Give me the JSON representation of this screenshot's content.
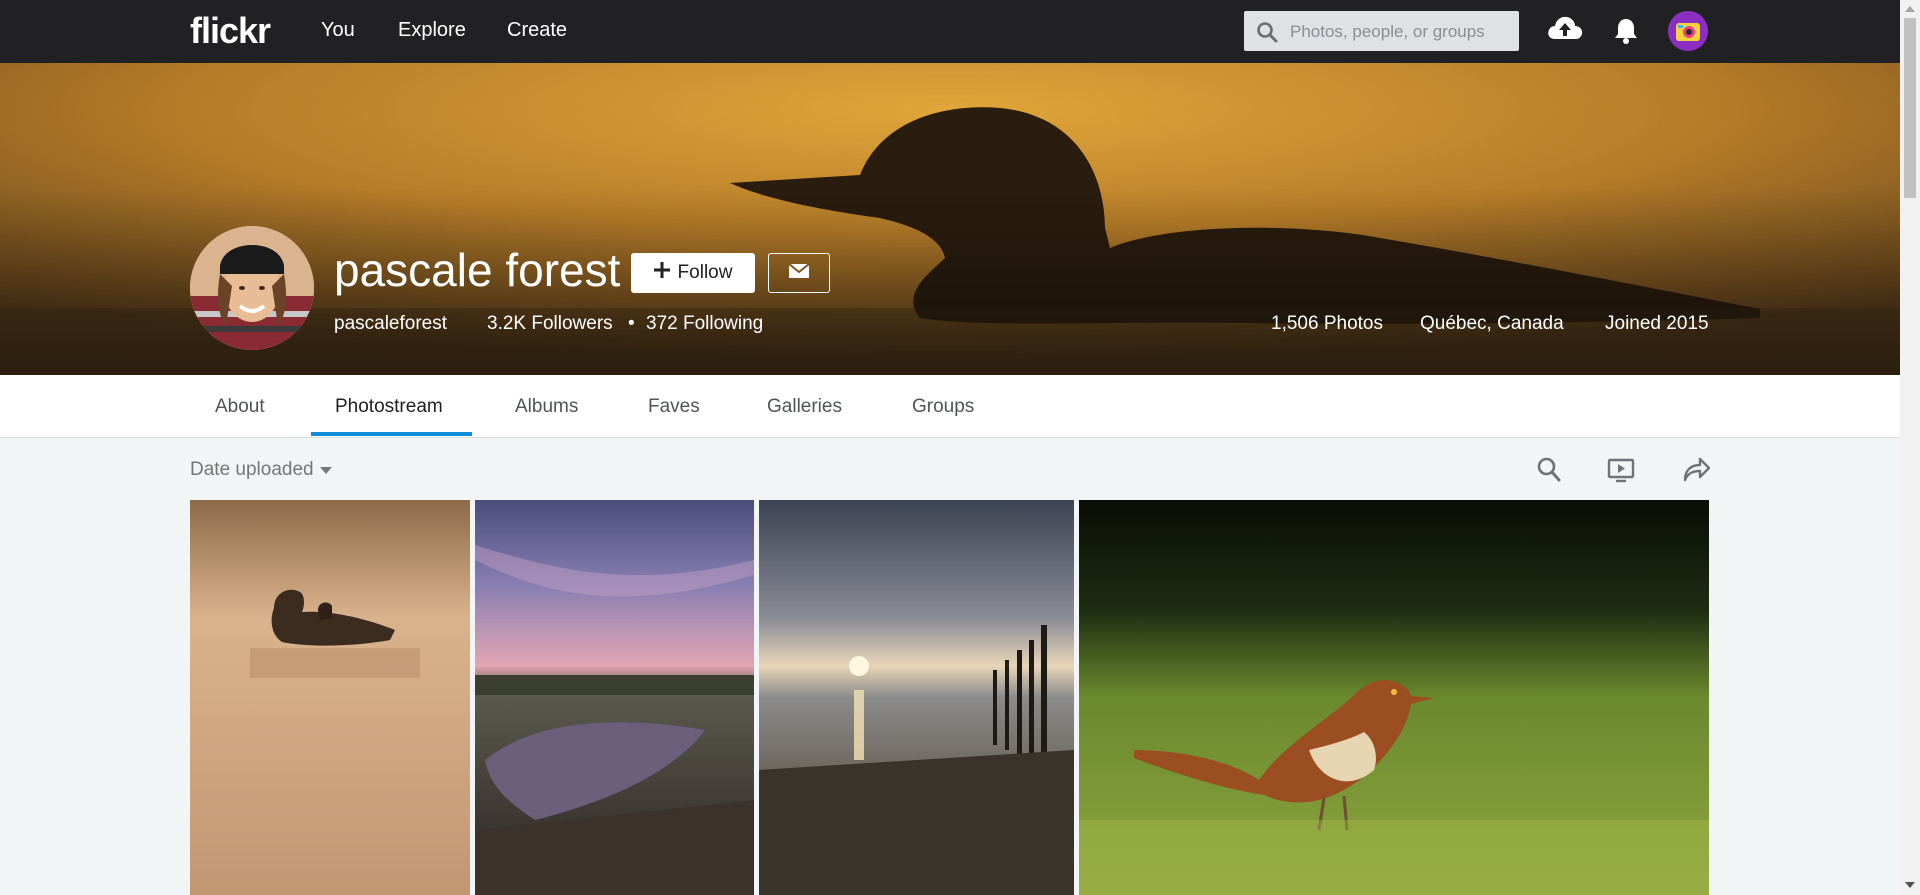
{
  "nav": {
    "logo": "flickr",
    "links": [
      "You",
      "Explore",
      "Create"
    ],
    "search_placeholder": "Photos, people, or groups",
    "icons": [
      "upload-cloud-icon",
      "bell-icon",
      "user-avatar"
    ]
  },
  "profile": {
    "name": "pascale forest",
    "username": "pascaleforest",
    "followers": "3.2K Followers",
    "separator": "•",
    "following": "372 Following",
    "photos": "1,506 Photos",
    "location": "Québec, Canada",
    "joined": "Joined 2015",
    "follow_label": "Follow"
  },
  "tabs": [
    {
      "label": "About",
      "active": false
    },
    {
      "label": "Photostream",
      "active": true
    },
    {
      "label": "Albums",
      "active": false
    },
    {
      "label": "Faves",
      "active": false
    },
    {
      "label": "Galleries",
      "active": false
    },
    {
      "label": "Groups",
      "active": false
    }
  ],
  "toolbar": {
    "sort_label": "Date uploaded",
    "icons": [
      "search-icon",
      "slideshow-icon",
      "share-icon"
    ]
  },
  "photos": [
    {
      "subject": "loon in fog"
    },
    {
      "subject": "shoreline at dusk"
    },
    {
      "subject": "sunset pier"
    },
    {
      "subject": "brown thrasher in grass"
    }
  ],
  "colors": {
    "nav_bg": "#212124",
    "accent_blue": "#128fdc",
    "page_bg": "#f2f5f6"
  }
}
